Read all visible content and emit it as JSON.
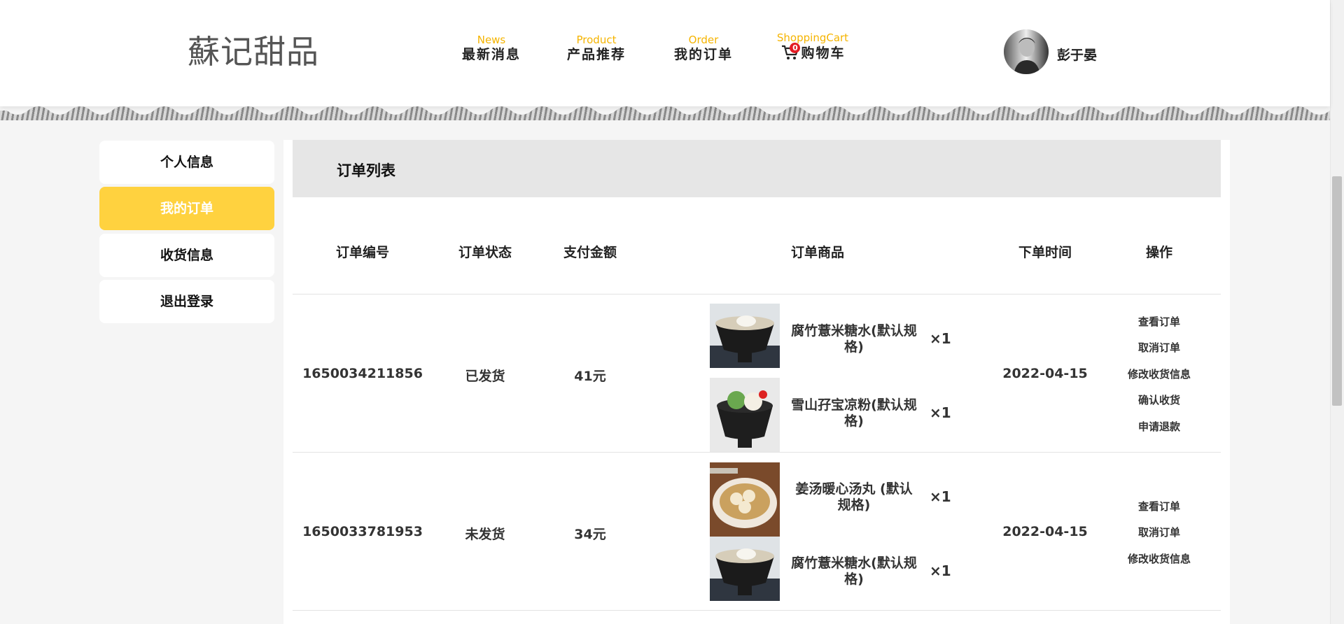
{
  "header": {
    "logo": "蘇记甜品",
    "nav": [
      {
        "en": "News",
        "cn": "最新消息"
      },
      {
        "en": "Product",
        "cn": "产品推荐"
      },
      {
        "en": "Order",
        "cn": "我的订单"
      },
      {
        "en": "ShoppingCart",
        "cn": "购物车"
      }
    ],
    "cart_count": "0",
    "username": "彭于晏"
  },
  "sidebar": {
    "items": [
      {
        "label": "个人信息"
      },
      {
        "label": "我的订单"
      },
      {
        "label": "收货信息"
      },
      {
        "label": "退出登录"
      }
    ],
    "active_index": 1
  },
  "main": {
    "title": "订单列表",
    "columns": [
      "订单编号",
      "订单状态",
      "支付金额",
      "订单商品",
      "下单时间",
      "操作"
    ],
    "orders": [
      {
        "id": "1650034211856",
        "status": "已发货",
        "amount": "41元",
        "date": "2022-04-15",
        "items": [
          {
            "name": "腐竹薏米糖水(默认规格)",
            "qty": "×1",
            "image": "tofu-skin-barley-dessert"
          },
          {
            "name": "雪山孖宝凉粉(默认规格)",
            "qty": "×1",
            "image": "snow-mountain-jelly-dessert"
          }
        ],
        "actions": [
          "查看订单",
          "取消订单",
          "修改收货信息",
          "确认收货",
          "申请退款"
        ]
      },
      {
        "id": "1650033781953",
        "status": "未发货",
        "amount": "34元",
        "date": "2022-04-15",
        "items": [
          {
            "name": "姜汤暖心汤丸 (默认规格)",
            "qty": "×1",
            "image": "ginger-soup-rice-balls"
          },
          {
            "name": "腐竹薏米糖水(默认规格)",
            "qty": "×1",
            "image": "tofu-skin-barley-dessert"
          }
        ],
        "actions": [
          "查看订单",
          "取消订单",
          "修改收货信息"
        ]
      }
    ]
  },
  "colors": {
    "accent": "#ffd23f",
    "nav_en": "#f5b400",
    "badge": "#e31b23"
  }
}
